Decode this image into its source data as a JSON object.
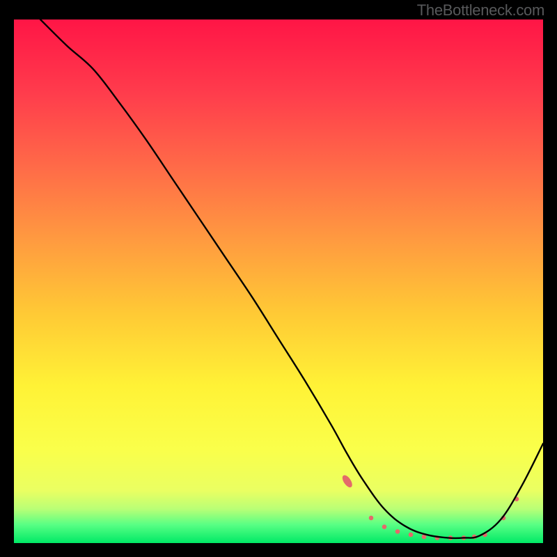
{
  "watermark": "TheBottleneck.com",
  "gradient": {
    "stops": [
      {
        "offset": 0.0,
        "color": "#ff1546"
      },
      {
        "offset": 0.14,
        "color": "#ff3c4c"
      },
      {
        "offset": 0.28,
        "color": "#ff6a48"
      },
      {
        "offset": 0.42,
        "color": "#ff9a40"
      },
      {
        "offset": 0.56,
        "color": "#ffc935"
      },
      {
        "offset": 0.7,
        "color": "#fff236"
      },
      {
        "offset": 0.82,
        "color": "#faff4a"
      },
      {
        "offset": 0.9,
        "color": "#eaff62"
      },
      {
        "offset": 0.935,
        "color": "#b9ff76"
      },
      {
        "offset": 0.965,
        "color": "#58ff84"
      },
      {
        "offset": 1.0,
        "color": "#00e966"
      }
    ]
  },
  "chart_data": {
    "type": "line",
    "title": "",
    "xlabel": "",
    "ylabel": "",
    "xlim": [
      0,
      100
    ],
    "ylim": [
      0,
      100
    ],
    "series": [
      {
        "name": "bottleneck-curve",
        "x": [
          5,
          10,
          15,
          20,
          25,
          30,
          35,
          40,
          45,
          50,
          55,
          60,
          63,
          66,
          70,
          74,
          78,
          82,
          85,
          88,
          92,
          96,
          100
        ],
        "y": [
          100,
          95,
          90.5,
          84,
          77,
          69.5,
          62,
          54.5,
          47,
          39,
          31,
          22.5,
          17,
          12,
          6.5,
          3.2,
          1.6,
          1.0,
          1.0,
          1.4,
          4.5,
          11,
          19
        ]
      }
    ],
    "markers": {
      "name": "sample-points",
      "color": "#e36a6a",
      "points": [
        {
          "x": 63.0,
          "y": 11.8,
          "rshort": 5.0,
          "rlong": 10.0,
          "angle": 56
        },
        {
          "x": 67.5,
          "y": 4.8,
          "rshort": 3.3,
          "rlong": 3.3,
          "angle": 0
        },
        {
          "x": 70.0,
          "y": 3.1,
          "rshort": 3.3,
          "rlong": 3.3,
          "angle": 0
        },
        {
          "x": 72.5,
          "y": 2.2,
          "rshort": 3.3,
          "rlong": 3.3,
          "angle": 0
        },
        {
          "x": 75.0,
          "y": 1.6,
          "rshort": 3.3,
          "rlong": 3.3,
          "angle": 0
        },
        {
          "x": 77.5,
          "y": 1.2,
          "rshort": 3.3,
          "rlong": 3.3,
          "angle": 0
        },
        {
          "x": 80.0,
          "y": 1.0,
          "rshort": 3.3,
          "rlong": 3.3,
          "angle": 0
        },
        {
          "x": 82.5,
          "y": 1.0,
          "rshort": 3.3,
          "rlong": 3.3,
          "angle": 0
        },
        {
          "x": 85.0,
          "y": 1.0,
          "rshort": 3.3,
          "rlong": 3.3,
          "angle": 0
        },
        {
          "x": 87.0,
          "y": 1.2,
          "rshort": 3.3,
          "rlong": 3.3,
          "angle": 0
        },
        {
          "x": 89.0,
          "y": 1.6,
          "rshort": 3.3,
          "rlong": 3.3,
          "angle": 0
        },
        {
          "x": 92.5,
          "y": 4.8,
          "rshort": 3.3,
          "rlong": 3.3,
          "angle": 0
        },
        {
          "x": 95.0,
          "y": 8.4,
          "rshort": 3.3,
          "rlong": 3.3,
          "angle": 0
        }
      ]
    }
  }
}
